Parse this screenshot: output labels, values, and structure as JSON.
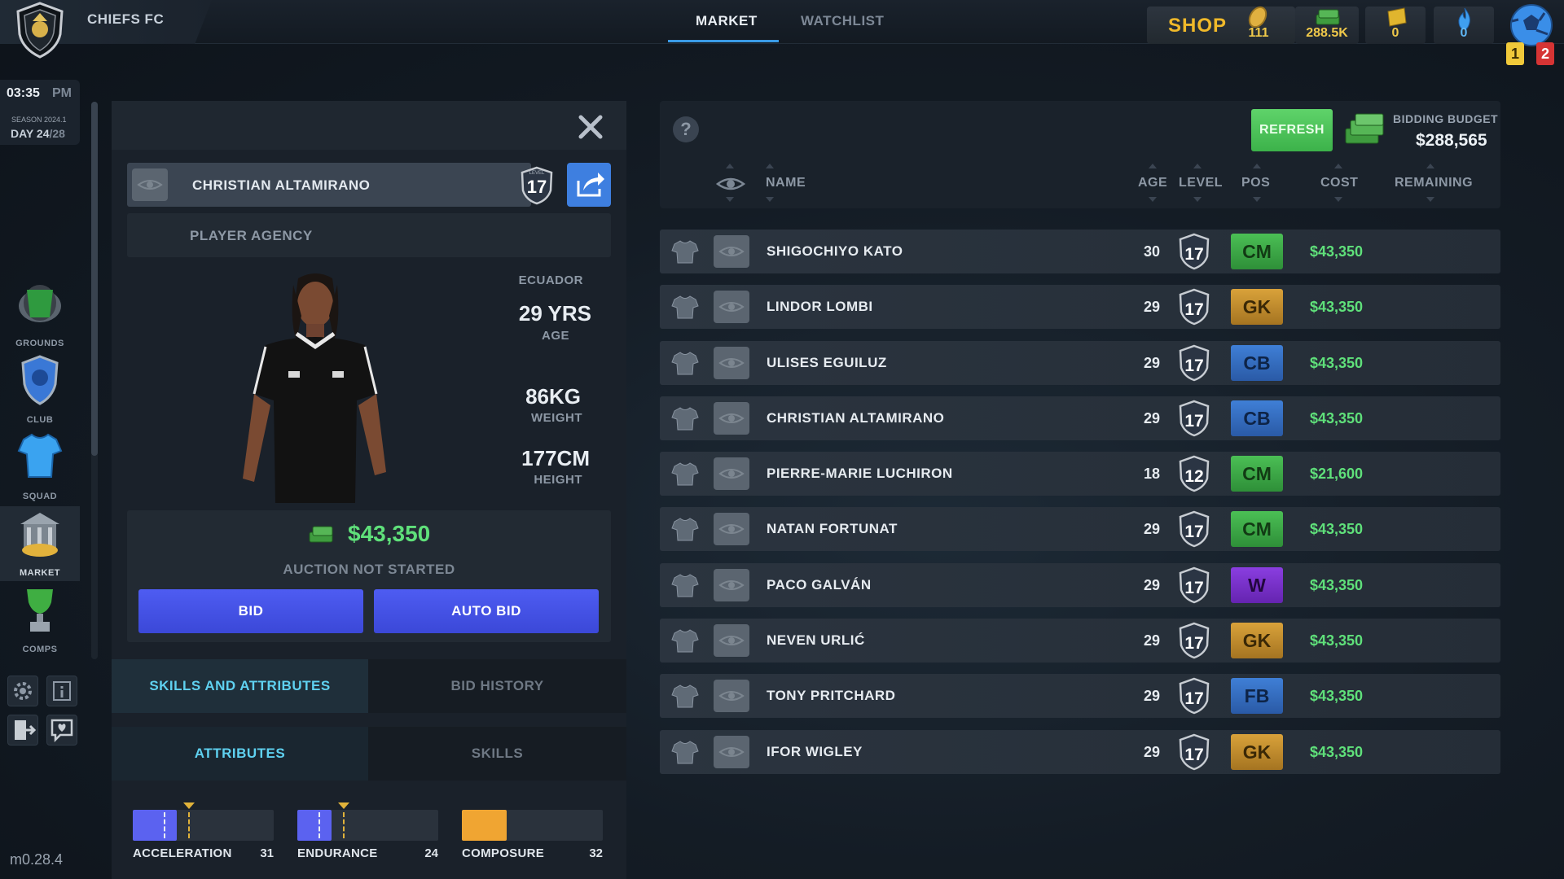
{
  "header": {
    "club_name": "CHIEFS FC",
    "tabs": [
      {
        "label": "MARKET",
        "active": true
      },
      {
        "label": "WATCHLIST",
        "active": false
      }
    ],
    "shop_label": "SHOP",
    "currencies": [
      {
        "icon": "coin-icon",
        "value": "111"
      },
      {
        "icon": "cash-stack-icon",
        "value": "288.5K"
      },
      {
        "icon": "ticket-icon",
        "value": "0"
      },
      {
        "icon": "flame-icon",
        "value": "0"
      }
    ],
    "notifications": {
      "yellow": "1",
      "red": "2"
    }
  },
  "clock": {
    "time": "03:35",
    "ampm": "PM",
    "season": "SEASON 2024.1",
    "day": "DAY 24",
    "day_total": "/28"
  },
  "sidebar": {
    "items": [
      {
        "label": "GROUNDS",
        "icon": "stadium-icon",
        "active": false
      },
      {
        "label": "CLUB",
        "icon": "club-crest-icon",
        "active": false
      },
      {
        "label": "SQUAD",
        "icon": "jersey-icon",
        "active": false
      },
      {
        "label": "MARKET",
        "icon": "market-building-icon",
        "active": true
      },
      {
        "label": "COMPS",
        "icon": "trophy-icon",
        "active": false
      }
    ],
    "version": "m0.28.4"
  },
  "player": {
    "name": "CHRISTIAN ALTAMIRANO",
    "level": "17",
    "level_caption": "LEVEL",
    "agency": "PLAYER AGENCY",
    "nationality": "ECUADOR",
    "age_value": "29 YRS",
    "age_label": "AGE",
    "weight_value": "86KG",
    "weight_label": "WEIGHT",
    "height_value": "177CM",
    "height_label": "HEIGHT",
    "price": "$43,350",
    "auction_status": "AUCTION NOT STARTED",
    "bid_label": "BID",
    "auto_bid_label": "AUTO BID"
  },
  "detail_tabs": {
    "main": [
      {
        "label": "SKILLS AND ATTRIBUTES",
        "active": true
      },
      {
        "label": "BID HISTORY",
        "active": false
      }
    ],
    "sub": [
      {
        "label": "ATTRIBUTES",
        "active": true
      },
      {
        "label": "SKILLS",
        "active": false
      }
    ]
  },
  "attributes": [
    {
      "label": "ACCELERATION",
      "value": "31",
      "fill": 0.31,
      "color": "#5b62f0"
    },
    {
      "label": "ENDURANCE",
      "value": "24",
      "fill": 0.24,
      "color": "#5b62f0"
    },
    {
      "label": "COMPOSURE",
      "value": "32",
      "fill": 0.32,
      "color": "#f0a532"
    }
  ],
  "market": {
    "refresh_label": "REFRESH",
    "budget_label": "BIDDING BUDGET",
    "budget_value": "$288,565",
    "columns": {
      "name": "NAME",
      "age": "AGE",
      "level": "LEVEL",
      "pos": "POS",
      "cost": "COST",
      "remaining": "REMAINING"
    },
    "rows": [
      {
        "name": "SHIGOCHIYO KATO",
        "age": "30",
        "level": "17",
        "pos": "CM",
        "cost": "$43,350"
      },
      {
        "name": "LINDOR LOMBI",
        "age": "29",
        "level": "17",
        "pos": "GK",
        "cost": "$43,350"
      },
      {
        "name": "ULISES EGUILUZ",
        "age": "29",
        "level": "17",
        "pos": "CB",
        "cost": "$43,350"
      },
      {
        "name": "CHRISTIAN ALTAMIRANO",
        "age": "29",
        "level": "17",
        "pos": "CB",
        "cost": "$43,350"
      },
      {
        "name": "PIERRE-MARIE LUCHIRON",
        "age": "18",
        "level": "12",
        "pos": "CM",
        "cost": "$21,600"
      },
      {
        "name": "NATAN FORTUNAT",
        "age": "29",
        "level": "17",
        "pos": "CM",
        "cost": "$43,350"
      },
      {
        "name": "PACO GALVÁN",
        "age": "29",
        "level": "17",
        "pos": "W",
        "cost": "$43,350"
      },
      {
        "name": "NEVEN URLIĆ",
        "age": "29",
        "level": "17",
        "pos": "GK",
        "cost": "$43,350"
      },
      {
        "name": "TONY PRITCHARD",
        "age": "29",
        "level": "17",
        "pos": "FB",
        "cost": "$43,350"
      },
      {
        "name": "IFOR WIGLEY",
        "age": "29",
        "level": "17",
        "pos": "GK",
        "cost": "$43,350"
      }
    ]
  },
  "colors": {
    "accent_blue": "#3e7fe0",
    "money_green": "#5fe07a",
    "refresh_green": "#4cc35a",
    "bid_blue": "#4552e6",
    "shop_gold": "#f0b92a"
  }
}
